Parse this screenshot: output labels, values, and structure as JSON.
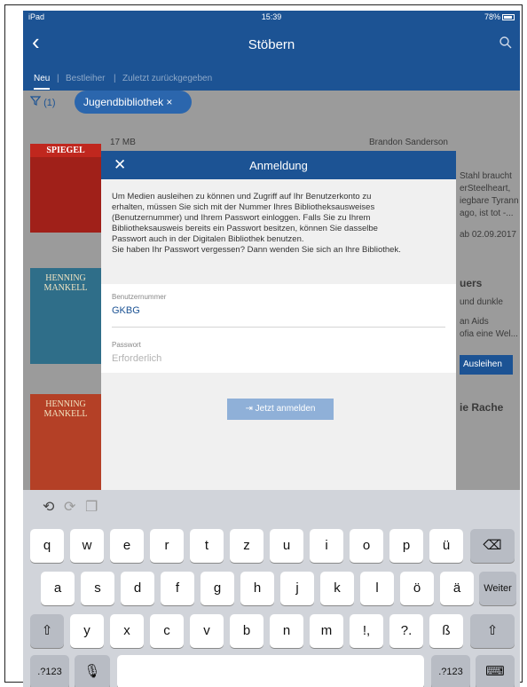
{
  "status_bar": {
    "device": "iPad",
    "time": "15:39",
    "battery": "78%"
  },
  "nav": {
    "title": "Stöbern",
    "back_icon": "chevron-left-icon",
    "search_icon": "search-icon"
  },
  "tabs": [
    {
      "label": "Neu"
    },
    {
      "label": "Bestleiher"
    },
    {
      "label": "Zuletzt zurückgegeben"
    }
  ],
  "filter": {
    "count": "(1)",
    "chip_label": "Jugendbibliothek ×"
  },
  "background": {
    "item1_meta": "17 MB",
    "item2_author": "Brandon Sanderson",
    "item2_desc_lines": [
      "Stahl braucht",
      "erSteelheart,",
      "iegbare Tyrann",
      "ago, ist tot -..."
    ],
    "item2_date": "ab 02.09.2017",
    "item3_title": "uers",
    "item3_desc_lines": [
      "und dunkle",
      "an Aids",
      "ofia eine Wel..."
    ],
    "borrow_label": "Ausleihen",
    "item4_title": "ie Rache",
    "cover1_text": "SPIEGEL",
    "cover2_text": "HENNING MANKELL",
    "cover3_text": "HENNING MANKELL"
  },
  "modal": {
    "title": "Anmeldung",
    "close_icon": "close-icon",
    "info_lines": [
      "Um Medien ausleihen zu können und Zugriff auf Ihr Benutzerkonto zu",
      "erhalten, müssen Sie sich mit der Nummer Ihres Bibliotheksausweises",
      "(Benutzernummer) und Ihrem Passwort einloggen. Falls Sie zu Ihrem",
      "Bibliotheksausweis bereits ein Passwort besitzen, können Sie dasselbe",
      "Passwort auch in der Digitalen Bibliothek benutzen.",
      "Sie haben Ihr Passwort vergessen? Dann wenden Sie sich an Ihre Bibliothek."
    ],
    "user_label": "Benutzernummer",
    "user_value": "GKBG",
    "password_label": "Passwort",
    "password_placeholder": "Erforderlich",
    "login_button": "Jetzt anmelden"
  },
  "keyboard": {
    "toolbar": [
      "undo-icon",
      "redo-icon",
      "paste-icon"
    ],
    "row1": [
      "q",
      "w",
      "e",
      "r",
      "t",
      "z",
      "u",
      "i",
      "o",
      "p",
      "ü"
    ],
    "row2": [
      "a",
      "s",
      "d",
      "f",
      "g",
      "h",
      "j",
      "k",
      "l",
      "ö",
      "ä"
    ],
    "row3": [
      "y",
      "x",
      "c",
      "v",
      "b",
      "n",
      "m",
      "!,",
      "?.",
      "ß"
    ],
    "return_label": "Weiter",
    "numbers_label": ".?123",
    "backspace_icon": "backspace-icon",
    "shift_icon": "shift-icon",
    "mic_icon": "microphone-icon",
    "hide_icon": "keyboard-hide-icon"
  }
}
